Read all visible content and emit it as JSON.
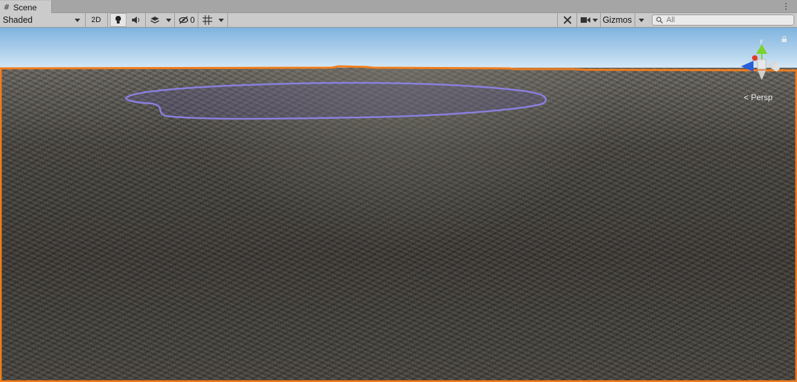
{
  "tab": {
    "label": "Scene",
    "icon": "grid-icon"
  },
  "toolbar": {
    "shading_mode": "Shaded",
    "btn_2d": "2D",
    "hidden_count": "0",
    "gizmos_label": "Gizmos",
    "search": {
      "placeholder": "All",
      "value": ""
    }
  },
  "viewport": {
    "gizmo_axis_label": "y",
    "projection_label": "< Persp",
    "selection_color": "#f07d1e",
    "highlight_color": "#8a80e0"
  }
}
